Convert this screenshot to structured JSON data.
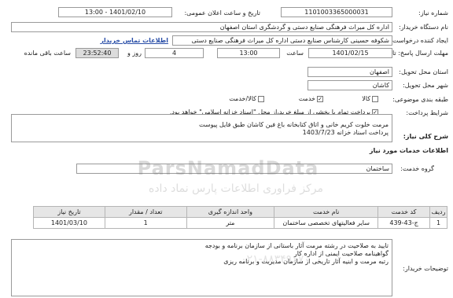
{
  "labels": {
    "need_number": "شماره نیاز:",
    "announce_datetime": "تاریخ و ساعت اعلان عمومی:",
    "buyer_org": "نام دستگاه خریدار:",
    "requester": "ایجاد کننده درخواست:",
    "deadline": "مهلت ارسال پاسخ: تا تاریخ",
    "time": "ساعت",
    "day_and": "روز و",
    "remaining": "ساعت باقی مانده",
    "province": "استان محل تحویل:",
    "city": "شهر محل تحویل:",
    "category": "طبقه بندی موضوعی:",
    "payment_terms": "شرایط پرداخت:",
    "general_desc": "شرح کلی نیاز:",
    "services_info": "اطلاعات خدمات مورد نیاز",
    "service_group": "گروه خدمت:",
    "buyer_notes": "توضیحات خریدار:"
  },
  "values": {
    "need_number": "1101003365000031",
    "announce_datetime": "1401/02/10 - 13:00",
    "buyer_org": "اداره کل میراث فرهنگی  صنایع دستی و گردشگری استان اصفهان",
    "requester": "شکوفه حسینی کارشناس صنایع دستی اداره کل میراث فرهنگی  صنایع دستی",
    "contact_link": "اطلاعات تماس خریدار",
    "deadline_date": "1401/02/15",
    "deadline_time": "13:00",
    "days_left": "4",
    "time_left": "23:52:40",
    "province": "اصفهان",
    "city": "کاشان",
    "service_group": "ساختمان"
  },
  "category_options": [
    {
      "label": "کالا",
      "checked": false
    },
    {
      "label": "خدمت",
      "checked": true
    },
    {
      "label": "کالا/خدمت",
      "checked": false
    }
  ],
  "payment_text": "پرداخت تمام یا بخشی از مبلغ خرید،از محل \"اسناد خزانه اسلامی\" خواهد بود.",
  "description_lines": [
    "مرمت خلوت کریم خانی و اتاق کتابخانه باغ فین کاشان طبق فایل پیوست",
    "پرداخت اسناد خزانه 1403/7/23"
  ],
  "table": {
    "headers": [
      "ردیف",
      "کد خدمت",
      "نام خدمت",
      "واحد اندازه گیری",
      "تعداد / مقدار",
      "تاریخ نیاز"
    ],
    "rows": [
      [
        "1",
        "ج-43-439",
        "سایر فعالیتهای تخصصی ساختمان",
        "متر",
        "1",
        "1401/03/10"
      ]
    ]
  },
  "notes_lines": [
    "تایید به صلاحیت در رشته مرمت آثار باستانی از سازمان برنامه و بودجه",
    "گواهینامه صلاحیت ایمنی از اداره کار",
    "رتبه مرمت  و ابنیه آثار تاریخی از سازمان مدیریت و برنامه ریزی"
  ],
  "watermark": {
    "brand": "ParsNamadData",
    "tagline": "مرکز فراوری اطلاعات پارس نماد داده",
    "phone": "۰۲۱-۸۸۳۴۹۶۷۰"
  },
  "colors": {
    "link": "#2a4fa8",
    "gray_field": "#dcdcdc",
    "border": "#9a9a9a"
  }
}
